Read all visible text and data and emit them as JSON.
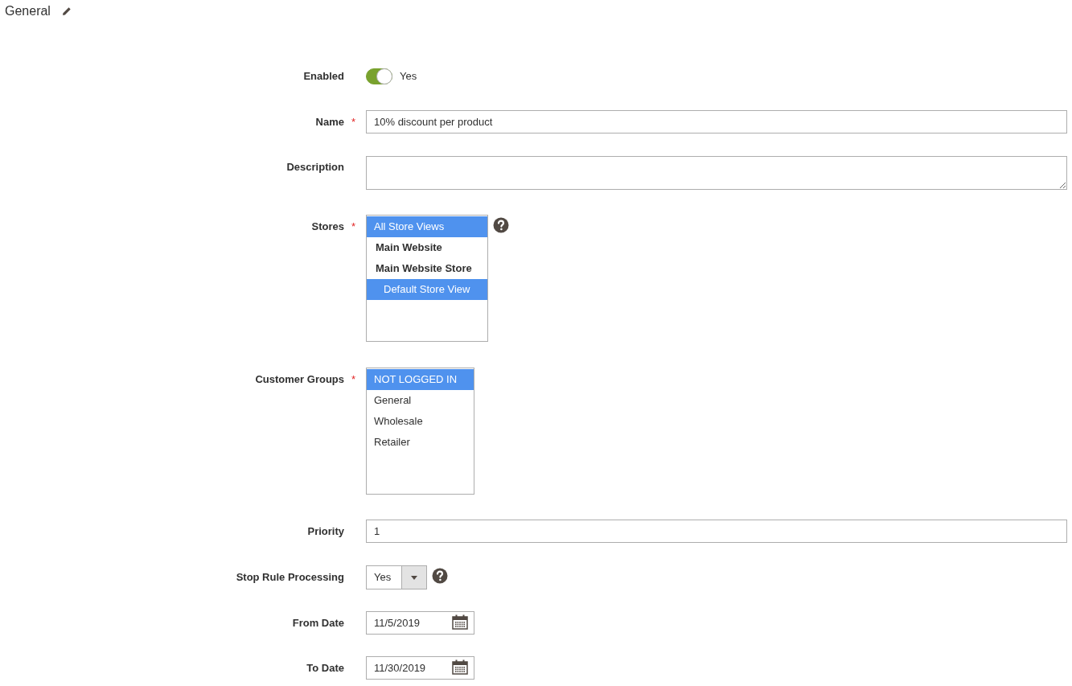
{
  "section": {
    "title": "General"
  },
  "fields": [
    {
      "kind": "toggle",
      "label": "Enabled",
      "on": true,
      "value": "Yes"
    },
    {
      "kind": "text",
      "label": "Name",
      "marker": "*",
      "value": "10% discount per product"
    },
    {
      "kind": "textarea",
      "label": "Description"
    },
    {
      "kind": "multiselect",
      "label": "Stores",
      "marker": "*",
      "help": true,
      "options": [
        {
          "kind": "all",
          "label": "All Store Views",
          "selected": true
        },
        {
          "kind": "website",
          "label": "Main Website",
          "selected": false
        },
        {
          "kind": "group",
          "label": "Main Website Store",
          "selected": false
        },
        {
          "kind": "view",
          "label": "Default Store View",
          "selected": true
        }
      ]
    },
    {
      "kind": "multiselect",
      "label": "Customer Groups",
      "marker": "*",
      "options": [
        {
          "kind": "all",
          "label": "NOT LOGGED IN",
          "selected": true
        },
        {
          "kind": "all",
          "label": "General",
          "selected": false
        },
        {
          "kind": "all",
          "label": "Wholesale",
          "selected": false
        },
        {
          "kind": "all",
          "label": "Retailer",
          "selected": false
        }
      ]
    },
    {
      "kind": "text",
      "label": "Priority",
      "value": "1"
    },
    {
      "kind": "select",
      "label": "Stop Rule Processing",
      "help": true,
      "value": "Yes"
    },
    {
      "kind": "date",
      "label": "From Date",
      "value": "11/5/2019"
    },
    {
      "kind": "date",
      "label": "To Date",
      "value": "11/30/2019"
    }
  ]
}
